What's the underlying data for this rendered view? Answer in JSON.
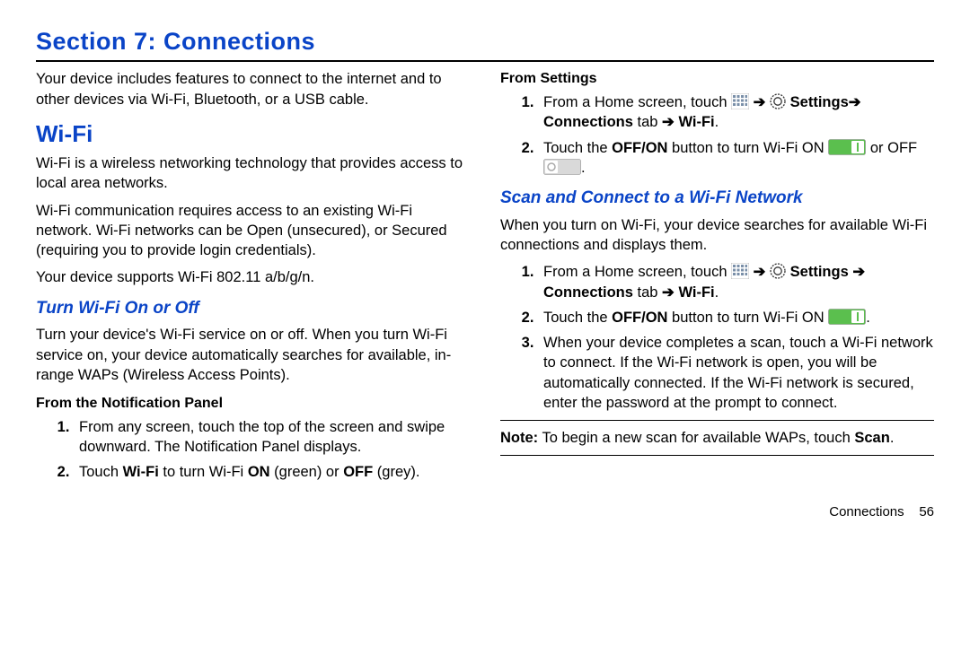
{
  "section_title": "Section 7: Connections",
  "intro": "Your device includes features to connect to the internet and to other devices via Wi-Fi, Bluetooth, or a USB cable.",
  "wifi": {
    "heading": "Wi-Fi",
    "p1": "Wi-Fi is a wireless networking technology that provides access to local area networks.",
    "p2": "Wi-Fi communication requires access to an existing Wi-Fi network. Wi-Fi networks can be Open (unsecured), or Secured (requiring you to provide login credentials).",
    "p3": "Your device supports Wi-Fi 802.11 a/b/g/n."
  },
  "turn": {
    "heading": "Turn Wi-Fi On or Off",
    "p1": "Turn your device's Wi-Fi service on or off. When you turn Wi-Fi service on, your device automatically searches for available, in-range WAPs (Wireless Access Points)."
  },
  "notif": {
    "heading": "From the Notification Panel",
    "step1": "From any screen, touch the top of the screen and swipe downward. The Notification Panel displays.",
    "step2_a": "Touch ",
    "step2_b": "Wi-Fi",
    "step2_c": " to turn Wi-Fi ",
    "step2_d": "ON",
    "step2_e": " (green) or ",
    "step2_f": "OFF",
    "step2_g": " (grey)."
  },
  "settings": {
    "heading": "From Settings",
    "s1_a": "From a Home screen, touch ",
    "s1_arrow": " ➔ ",
    "s1_settings": "Settings",
    "s1_arrow2": "➔ ",
    "s1_conn": "Connections",
    "s1_tab": " tab ",
    "s1_arrow3": "➔ ",
    "s1_wifi": "Wi-Fi",
    "s1_end": ".",
    "s2_a": "Touch the ",
    "s2_b": "OFF/ON",
    "s2_c": " button to turn Wi-Fi ON ",
    "s2_d": " or OFF ",
    "s2_e": "."
  },
  "scan": {
    "heading": "Scan and Connect to a Wi-Fi Network",
    "p1": "When you turn on Wi-Fi, your device searches for available Wi-Fi connections and displays them.",
    "s1_a": "From a Home screen, touch ",
    "s1_arrow": " ➔ ",
    "s1_settings": "Settings",
    "s1_arrow2": " ➔ ",
    "s1_conn": "Connections",
    "s1_tab": " tab ",
    "s1_arrow3": "➔ ",
    "s1_wifi": "Wi-Fi",
    "s1_end": ".",
    "s2_a": "Touch the ",
    "s2_b": "OFF/ON",
    "s2_c": " button to turn Wi-Fi ON ",
    "s2_d": ".",
    "s3": "When your device completes a scan, touch a Wi-Fi network to connect. If the Wi-Fi network is open, you will be automatically connected. If the Wi-Fi network is secured, enter the password at the prompt to connect."
  },
  "note": {
    "label": "Note:",
    "text_a": " To begin a new scan for available WAPs, touch ",
    "text_b": "Scan",
    "text_c": "."
  },
  "footer": {
    "name": "Connections",
    "page": "56"
  }
}
